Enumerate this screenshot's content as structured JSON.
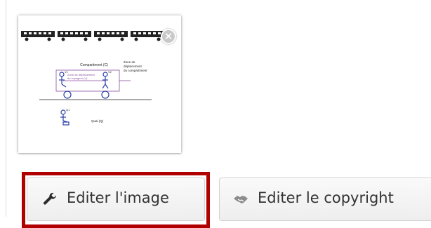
{
  "thumbnail": {
    "diagram_labels": {
      "compartment": "Compartiment (C)",
      "passenger_zone_line1": "Zone de déplacement",
      "passenger_zone_line2": "du voyageur (V)",
      "compartment_zone_line1": "Zone de",
      "compartment_zone_line2": "déplacement",
      "compartment_zone_line3": "du compartiment",
      "point_v1": "V1",
      "point_v2": "V2",
      "point_q": "Q1",
      "dock": "Quai (Q)"
    },
    "close_icon": "close-icon"
  },
  "toolbar": {
    "edit_image_label": "Editer l'image",
    "edit_image_icon": "wrench-icon",
    "edit_copyright_label": "Editer le copyright",
    "edit_copyright_icon": "handshake-icon"
  },
  "colors": {
    "highlight": "#b00000",
    "diagram_blue": "#2b3fa8",
    "diagram_purple": "#8a4f9e"
  }
}
